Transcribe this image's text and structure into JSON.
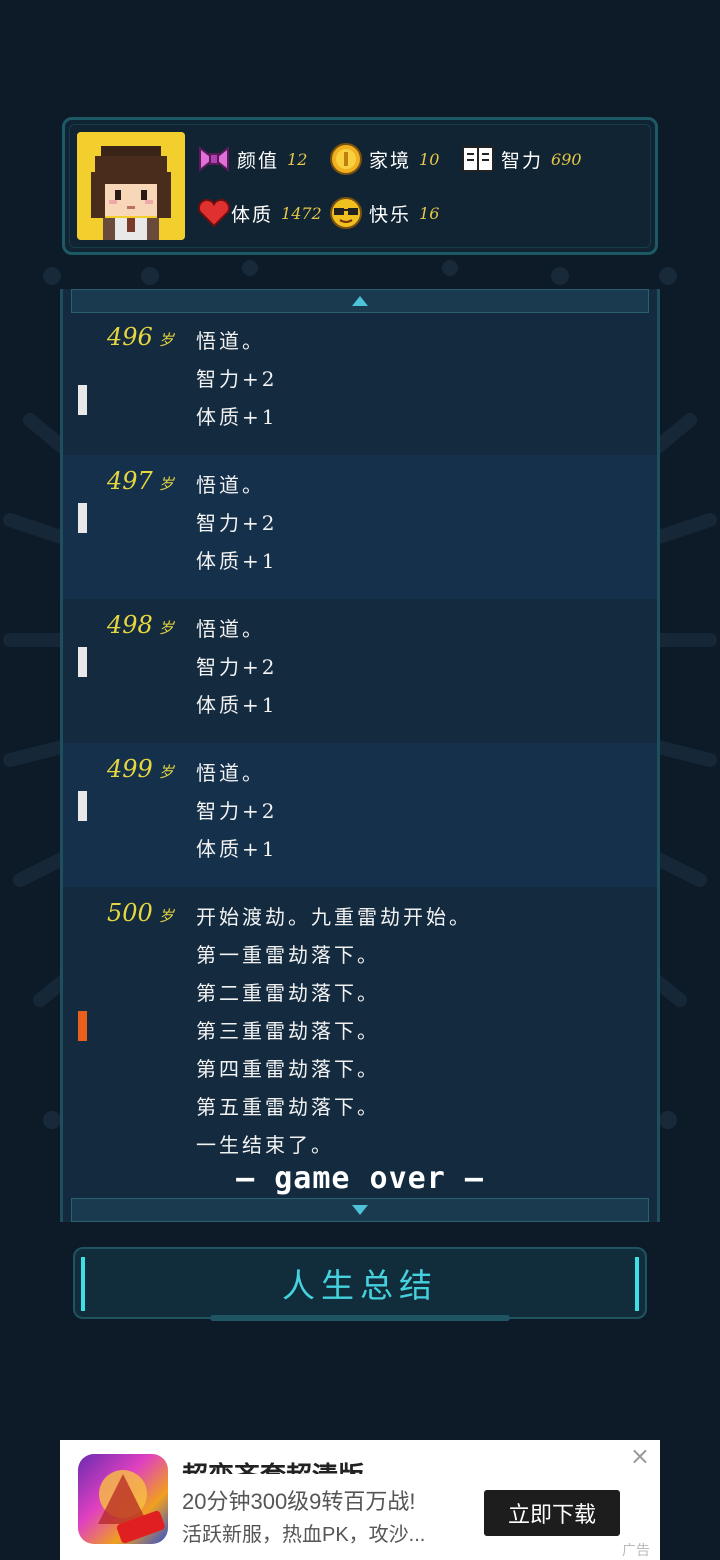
{
  "stats": [
    {
      "icon": "bow-icon",
      "label": "颜值",
      "value": "12"
    },
    {
      "icon": "coin-icon",
      "label": "家境",
      "value": "10"
    },
    {
      "icon": "book-icon",
      "label": "智力",
      "value": "690"
    },
    {
      "icon": "heart-icon",
      "label": "体质",
      "value": "1472"
    },
    {
      "icon": "sunglasses-icon",
      "label": "快乐",
      "value": "16"
    }
  ],
  "age_unit": "岁",
  "entries": [
    {
      "age": "496",
      "lines": [
        "悟道。",
        "智力+2",
        "体质+1"
      ]
    },
    {
      "age": "497",
      "lines": [
        "悟道。",
        "智力+2",
        "体质+1"
      ]
    },
    {
      "age": "498",
      "lines": [
        "悟道。",
        "智力+2",
        "体质+1"
      ]
    },
    {
      "age": "499",
      "lines": [
        "悟道。",
        "智力+2",
        "体质+1"
      ]
    },
    {
      "age": "500",
      "lines": [
        "开始渡劫。九重雷劫开始。",
        "第一重雷劫落下。",
        "第二重雷劫落下。",
        "第三重雷劫落下。",
        "第四重雷劫落下。",
        "第五重雷劫落下。",
        "一生结束了。"
      ]
    }
  ],
  "game_over": "— game over —",
  "summary_button": "人生总结",
  "ad": {
    "title": "超变齐套超清版",
    "line1": "20分钟300级9转百万战!",
    "line2": "活跃新服，热血PK，攻沙...",
    "cta": "立即下载",
    "close": "×",
    "tag": "广告"
  },
  "colors": {
    "accent": "#45d2de",
    "age": "#e6d640",
    "stat_value": "#e6c64a",
    "marker_danger": "#e8601c"
  }
}
